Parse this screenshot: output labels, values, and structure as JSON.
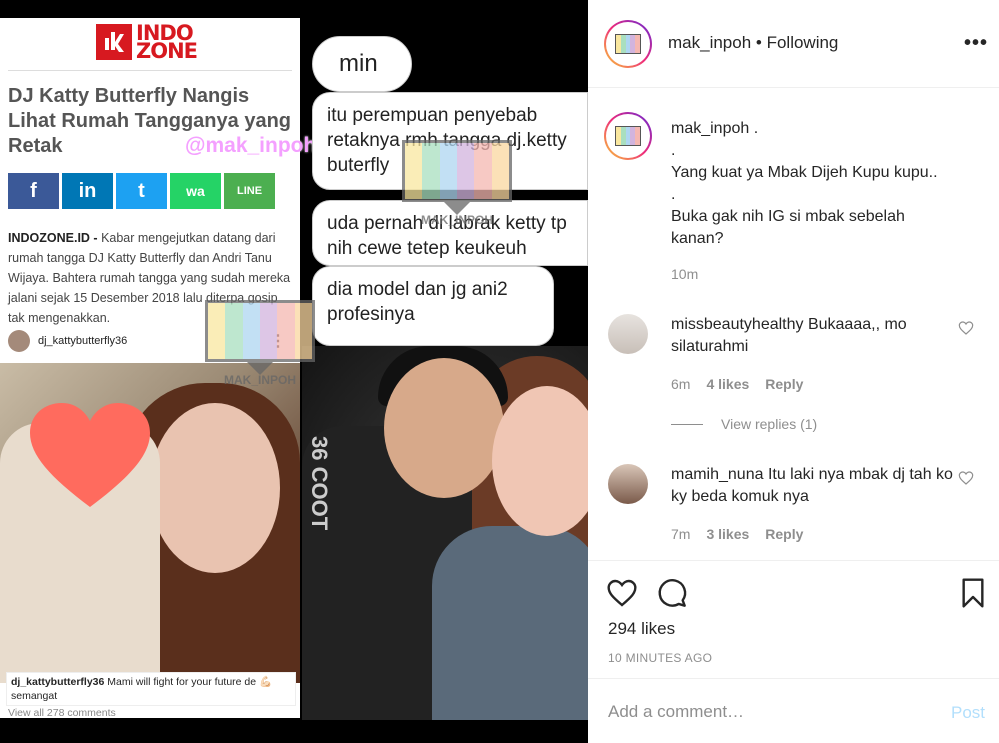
{
  "post_image": {
    "news": {
      "logo_line1": "INDO",
      "logo_line2": "ZONE",
      "headline": "DJ Katty Butterfly Nangis Lihat Rumah Tangganya yang Retak",
      "watermark_handle": "@mak_inpoh",
      "share_buttons": [
        "f",
        "in",
        "t",
        "wa",
        "LINE"
      ],
      "body_lead": "INDOZONE.ID -",
      "body_text": " Kabar mengejutkan datang dari rumah tangga DJ Katty Butterfly dan Andri Tanu Wijaya. Bahtera rumah tangga yang sudah mereka jalani sejak 15 Desember 2018 lalu diterpa gosip tak mengenakkan.",
      "ig_username": "dj_kattybutterfly36",
      "ig_more": "⋮",
      "caption_user": "dj_kattybutterfly36",
      "caption_text": " Mami will fight for your future de 💪🏻 semangat",
      "view_all": "View all 278 comments"
    },
    "chat": {
      "b1": "min",
      "b2": "itu perempuan penyebab retaknya rmh tangga dj.ketty buterfly",
      "b3": "uda pernah di labrak ketty tp nih cewe tetep keukeuh",
      "b4": "dia model dan jg ani2 profesinya"
    },
    "watermark_label": "MAK_INPOH",
    "shirt_text": "36 COOT"
  },
  "header": {
    "username": "mak_inpoh",
    "separator": " • ",
    "follow_state": "Following",
    "more": "•••"
  },
  "caption": {
    "username": "mak_inpoh",
    "lines": [
      " .",
      ".",
      "Yang kuat ya Mbak Dijeh Kupu kupu..",
      ".",
      "Buka gak nih IG si mbak sebelah kanan?"
    ],
    "time": "10m"
  },
  "comments": [
    {
      "username": "missbeautyhealthy",
      "text": " Bukaaaa,, mo silaturahmi",
      "time": "6m",
      "likes": "4 likes",
      "reply": "Reply"
    },
    {
      "username": "mamih_nuna",
      "text": " Itu laki nya mbak dj tah ko ky beda komuk nya",
      "time": "7m",
      "likes": "3 likes",
      "reply": "Reply"
    }
  ],
  "view_replies": "View replies (1)",
  "actions": {
    "likes": "294 likes",
    "timestamp": "10 MINUTES AGO"
  },
  "add_comment": {
    "placeholder": "Add a comment…",
    "post": "Post"
  },
  "colors": {
    "brand_red": "#d71920",
    "post_disabled": "#b2dffc",
    "meta_gray": "#8e8e8e"
  }
}
